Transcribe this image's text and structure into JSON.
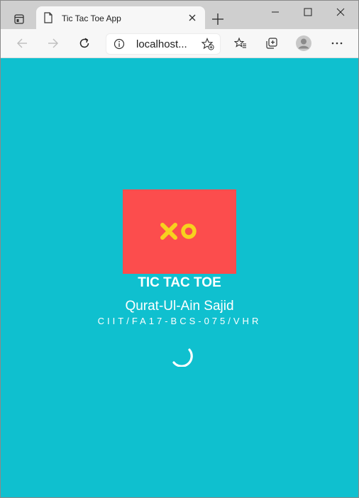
{
  "browser": {
    "tab_title": "Tic Tac Toe App",
    "address": "localhost...",
    "icons": {
      "tab_actions": "tab-actions-icon",
      "favicon": "page-icon",
      "close_tab": "close-icon",
      "new_tab": "plus-icon",
      "minimize": "minimize-icon",
      "maximize": "maximize-icon",
      "close_window": "close-icon",
      "back": "back-arrow-icon",
      "forward": "forward-arrow-icon",
      "refresh": "refresh-icon",
      "site_info": "info-icon",
      "add_favorite": "add-favorite-icon",
      "favorites": "favorites-icon",
      "collections": "collections-icon",
      "profile": "profile-icon",
      "more": "more-icon"
    }
  },
  "app": {
    "logo_glyphs": "XO",
    "title": "TIC TAC TOE",
    "author": "Qurat-Ul-Ain Sajid",
    "registration": "CIIT/FA17-BCS-075/VHR",
    "colors": {
      "background": "#0fc0cf",
      "logo_box": "#fc4d4d",
      "logo_glyph": "#f7d11e",
      "text": "#ffffff"
    }
  }
}
